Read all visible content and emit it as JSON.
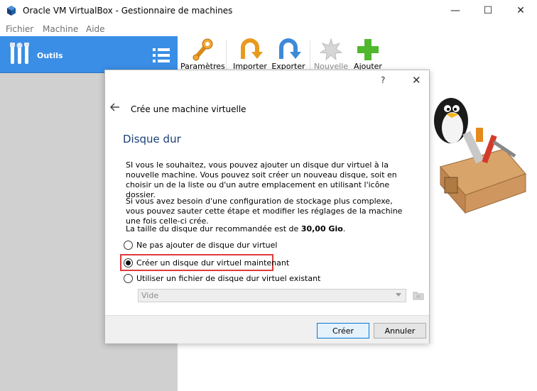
{
  "window": {
    "title": "Oracle VM VirtualBox - Gestionnaire de machines",
    "minimize_glyph": "—",
    "maximize_glyph": "☐",
    "close_glyph": "✕"
  },
  "menu": {
    "items": [
      "Fichier",
      "Machine",
      "Aide"
    ]
  },
  "tools": {
    "label": "Outils"
  },
  "toolbar": {
    "buttons": [
      {
        "label": "Paramètres",
        "icon": "gear-wrench-icon",
        "enabled": true
      },
      {
        "label": "Importer",
        "icon": "import-arrow-icon",
        "enabled": true
      },
      {
        "label": "Exporter",
        "icon": "export-arrow-icon",
        "enabled": true
      },
      {
        "label": "Nouvelle",
        "icon": "new-star-icon",
        "enabled": false
      },
      {
        "label": "Ajouter",
        "icon": "add-plus-icon",
        "enabled": true
      }
    ]
  },
  "dialog": {
    "help_glyph": "?",
    "close_glyph": "✕",
    "heading": "Crée une machine virtuelle",
    "section_title": "Disque dur",
    "paragraph1": "SI vous le souhaitez, vous pouvez ajouter un disque dur virtuel à la nouvelle machine. Vous pouvez soit créer un nouveau disque, soit en choisir un de la liste ou d'un autre emplacement en utilisant l'icône dossier.",
    "paragraph2": "Si vous avez besoin d'une configuration de stockage plus complexe, vous pouvez sauter cette étape et modifier les réglages de la machine une fois celle-ci crée.",
    "recommended_prefix": "La taille du disque dur recommandée est de ",
    "recommended_size": "30,00 Gio",
    "recommended_suffix": ".",
    "options": [
      {
        "label": "Ne pas ajouter de disque dur virtuel",
        "checked": false
      },
      {
        "label": "Créer un disque dur virtuel maintenant",
        "checked": true
      },
      {
        "label": "Utiliser un fichier de disque dur virtuel existant",
        "checked": false
      }
    ],
    "existing_disk_value": "Vide",
    "create_button": "Créer",
    "cancel_button": "Annuler"
  },
  "colors": {
    "tools_header": "#3a8ee6",
    "section_title": "#1b3f78",
    "highlight": "#e03a3a"
  }
}
